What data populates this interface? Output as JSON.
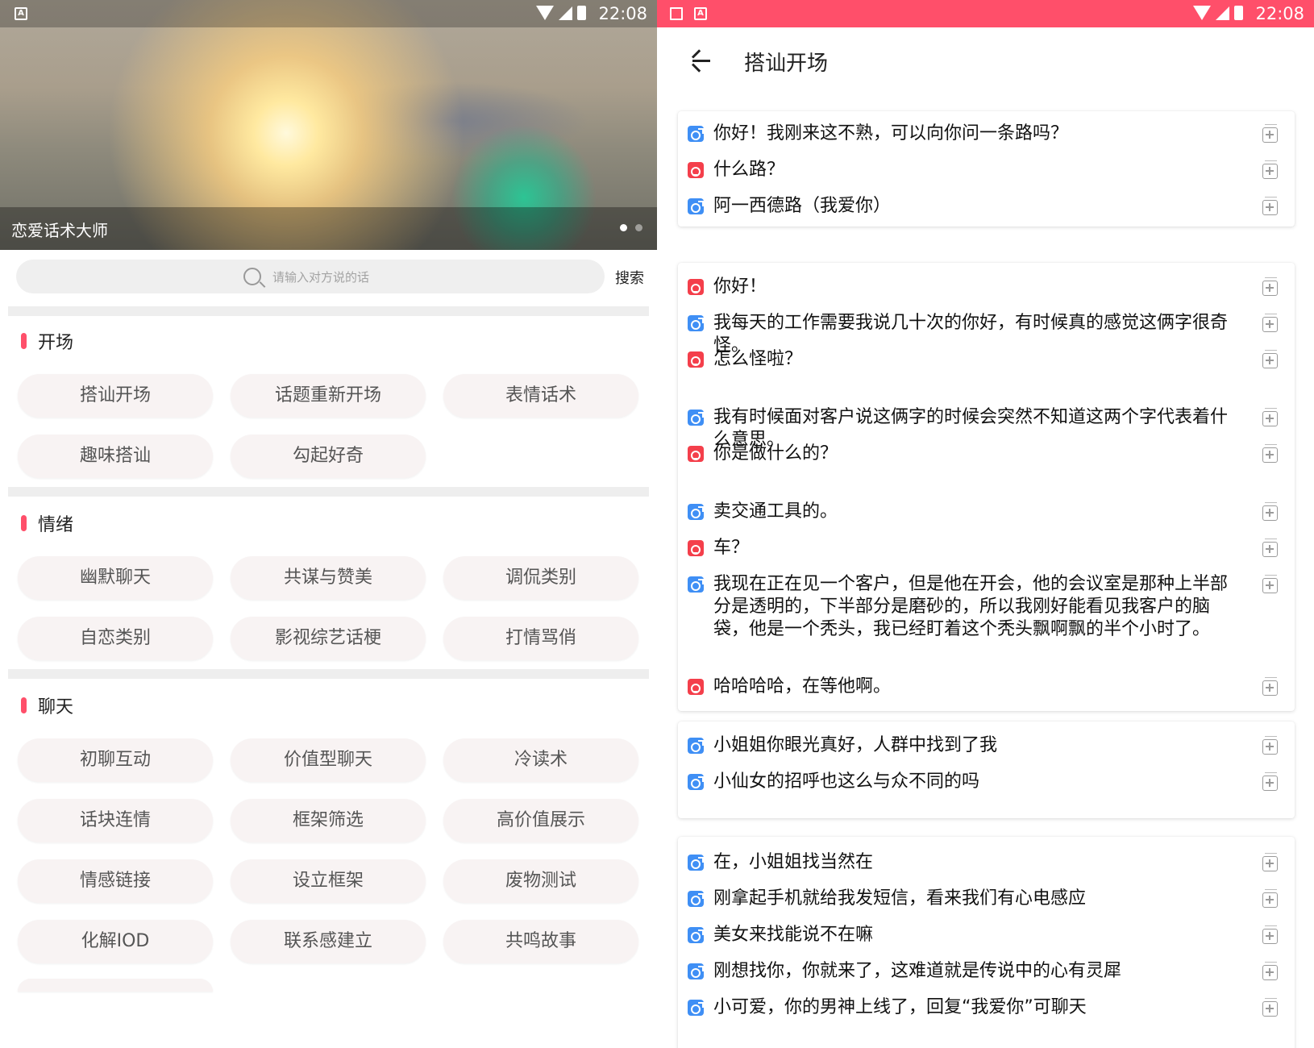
{
  "status": {
    "time": "22:08",
    "app_badge": "A"
  },
  "home": {
    "banner_caption": "恋爱话术大师",
    "search_placeholder": "请输入对方说的话",
    "search_button": "搜索",
    "sections": [
      {
        "title": "开场",
        "chips": [
          "搭讪开场",
          "话题重新开场",
          "表情话术",
          "趣味搭讪",
          "勾起好奇"
        ]
      },
      {
        "title": "情绪",
        "chips": [
          "幽默聊天",
          "共谋与赞美",
          "调侃类别",
          "自恋类别",
          "影视综艺话梗",
          "打情骂俏"
        ]
      },
      {
        "title": "聊天",
        "chips": [
          "初聊互动",
          "价值型聊天",
          "冷读术",
          "话块连情",
          "框架筛选",
          "高价值展示",
          "情感链接",
          "设立框架",
          "废物测试",
          "化解IOD",
          "联系感建立",
          "共鸣故事"
        ]
      }
    ]
  },
  "detail": {
    "title": "搭讪开场",
    "cards": [
      {
        "lines": [
          {
            "gender": "male",
            "text": "你好！我刚来这不熟，可以向你问一条路吗？"
          },
          {
            "gender": "female",
            "text": "什么路？"
          },
          {
            "gender": "male",
            "text": "阿一西德路（我爱你）"
          }
        ]
      },
      {
        "lines": [
          {
            "gender": "female",
            "text": "你好！"
          },
          {
            "gender": "male",
            "text": "我每天的工作需要我说几十次的你好，有时候真的感觉这俩字很奇怪。"
          },
          {
            "gender": "female",
            "text": "怎么怪啦？"
          },
          {
            "gender": "male",
            "text": "我有时候面对客户说这俩字的时候会突然不知道这两个字代表着什么意思。"
          },
          {
            "gender": "female",
            "text": "你是做什么的？"
          },
          {
            "gender": "male",
            "text": "卖交通工具的。"
          },
          {
            "gender": "female",
            "text": "车？"
          },
          {
            "gender": "male",
            "text": "我现在正在见一个客户，但是他在开会，他的会议室是那种上半部分是透明的，下半部分是磨砂的，所以我刚好能看见我客户的脑袋，他是一个秃头，我已经盯着这个秃头飘啊飘的半个小时了。"
          },
          {
            "gender": "female",
            "text": "哈哈哈哈，在等他啊。"
          }
        ]
      },
      {
        "lines": [
          {
            "gender": "male",
            "text": "小姐姐你眼光真好，人群中找到了我"
          },
          {
            "gender": "male",
            "text": "小仙女的招呼也这么与众不同的吗"
          }
        ]
      },
      {
        "lines": [
          {
            "gender": "male",
            "text": "在，小姐姐找当然在"
          },
          {
            "gender": "male",
            "text": "刚拿起手机就给我发短信，看来我们有心电感应"
          },
          {
            "gender": "male",
            "text": "美女来找能说不在嘛"
          },
          {
            "gender": "male",
            "text": "刚想找你，你就来了，这难道就是传说中的心有灵犀"
          },
          {
            "gender": "male",
            "text": "小可爱，你的男神上线了，回复“我爱你”可聊天"
          }
        ]
      }
    ]
  },
  "colors": {
    "accent": "#ff4f6a",
    "male": "#3f8ff5",
    "female": "#f43f4b"
  }
}
